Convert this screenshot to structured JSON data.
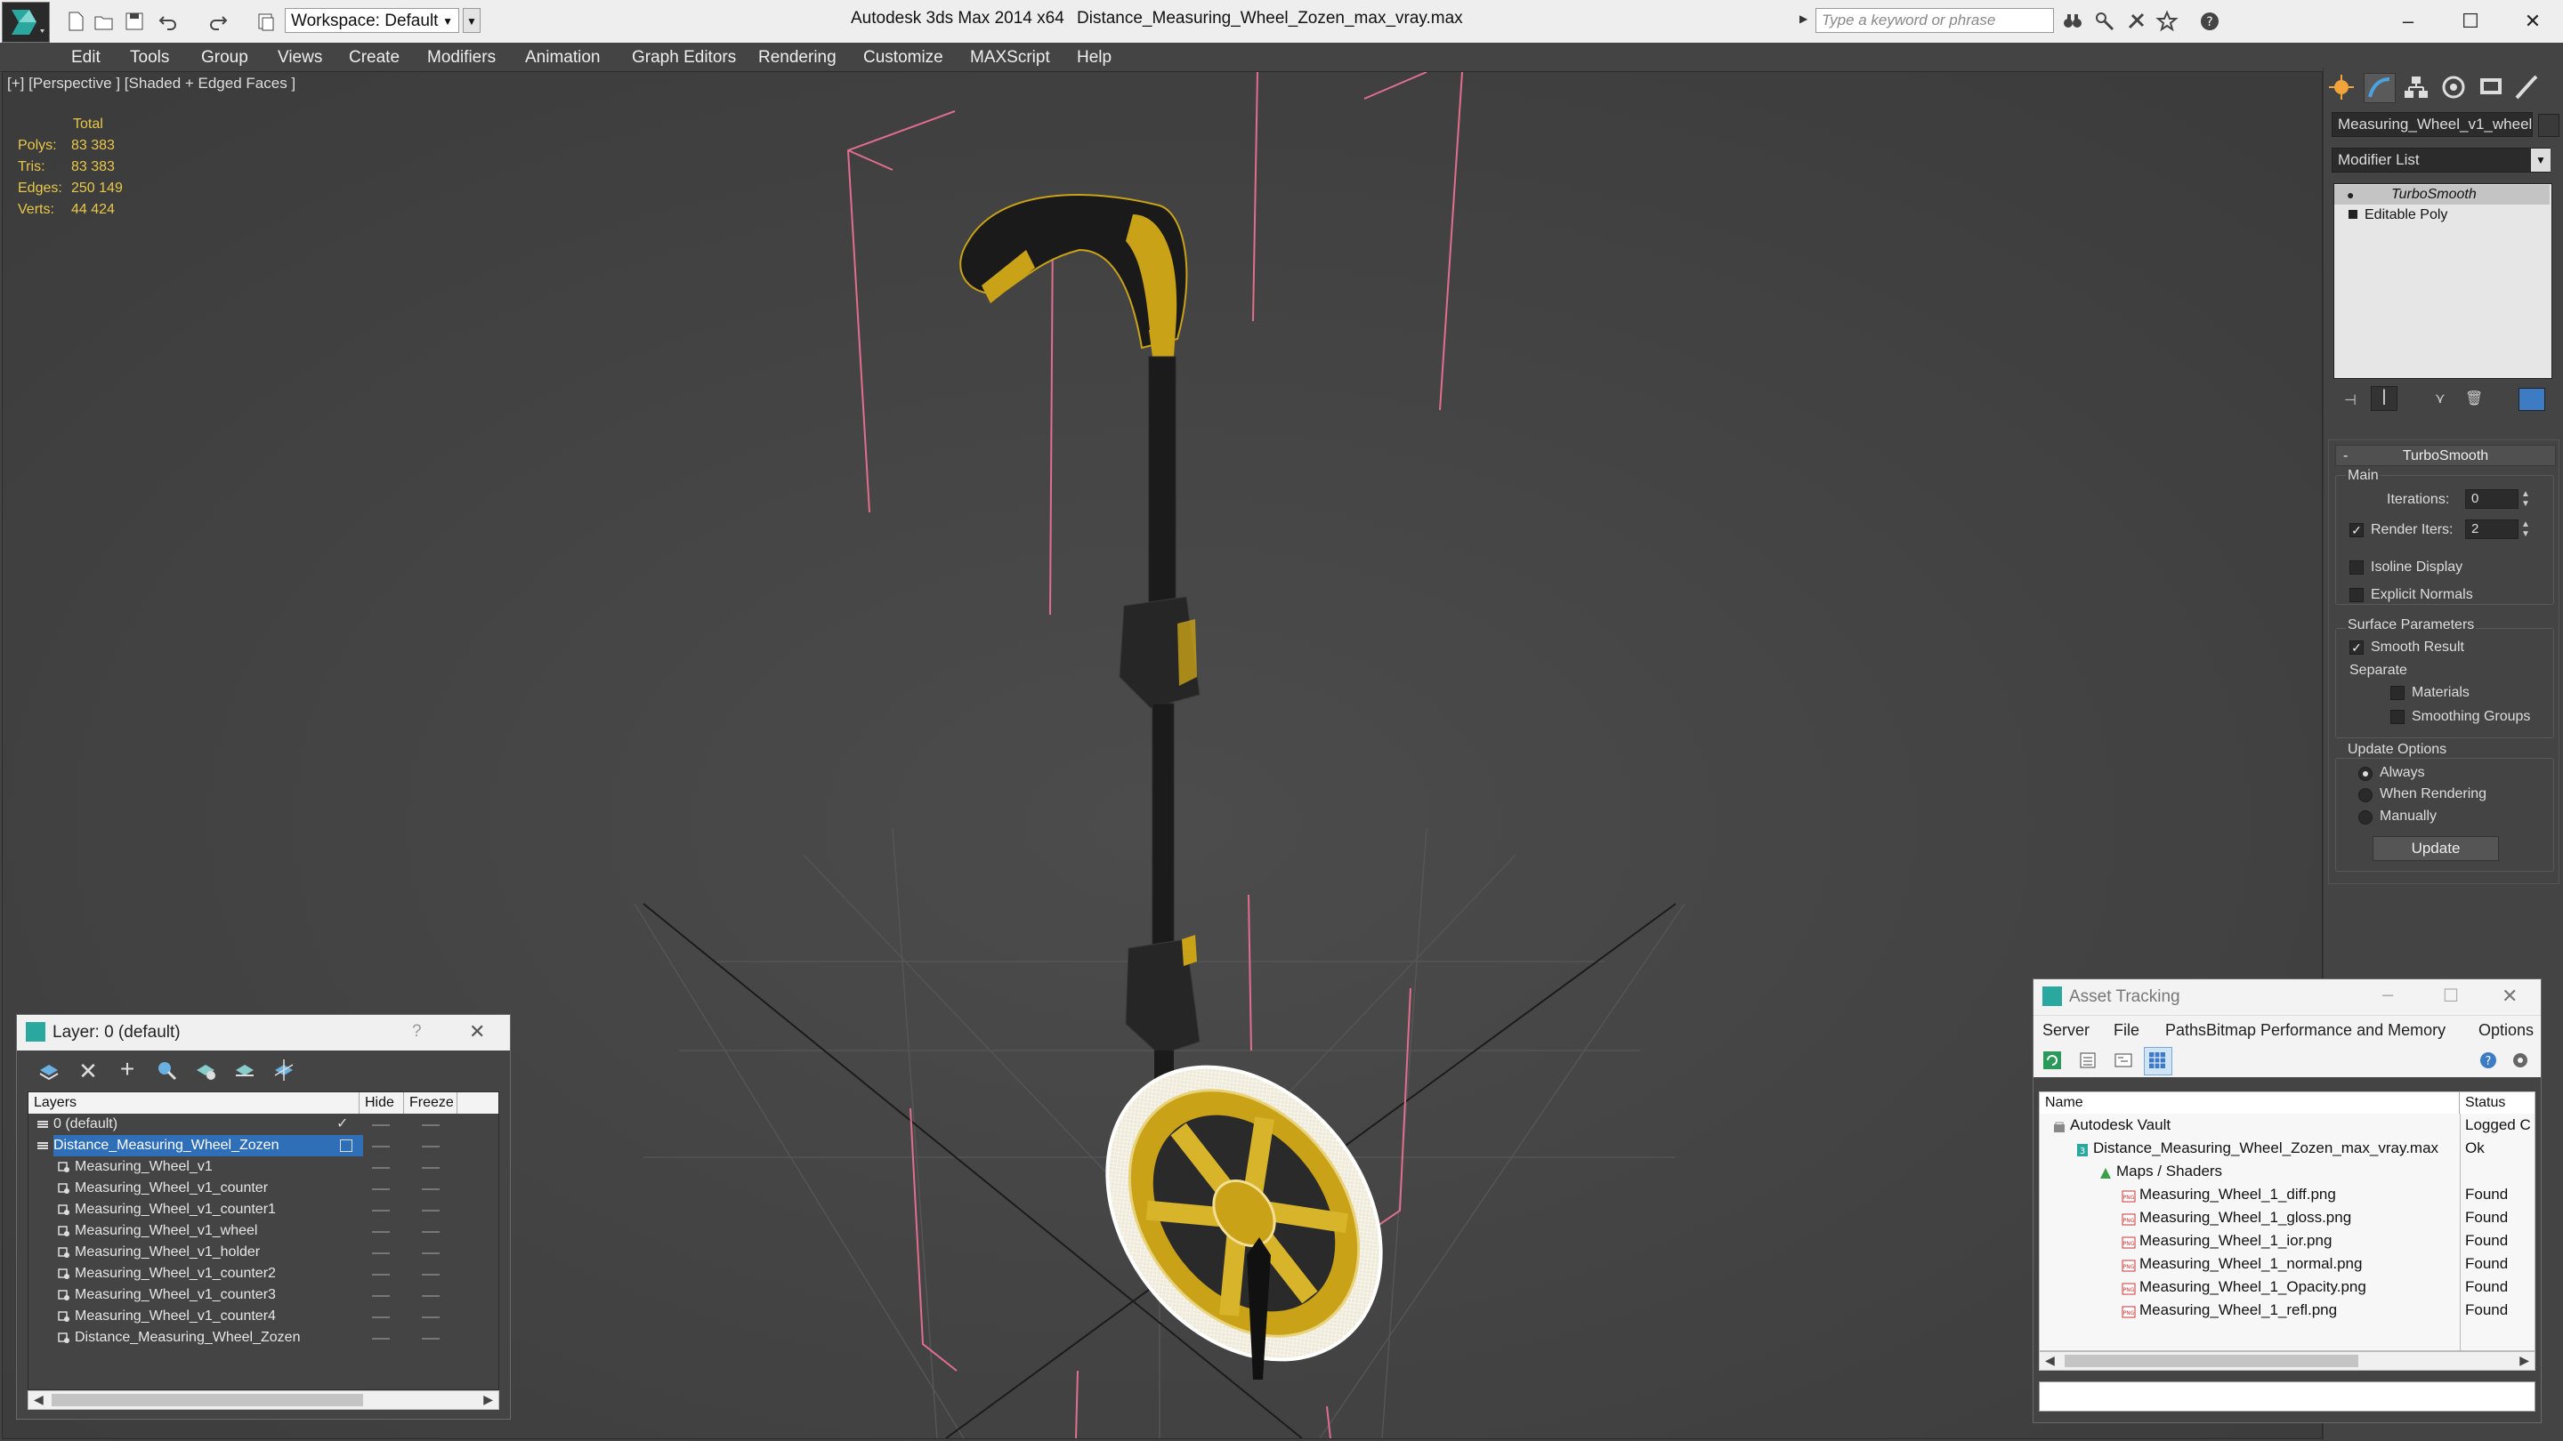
{
  "app": {
    "title": "Autodesk 3ds Max  2014 x64",
    "filename": "Distance_Measuring_Wheel_Zozen_max_vray.max",
    "workspace": "Workspace: Default",
    "search_placeholder": "Type a keyword or phrase"
  },
  "menu": [
    "Edit",
    "Tools",
    "Group",
    "Views",
    "Create",
    "Modifiers",
    "Animation",
    "Graph Editors",
    "Rendering",
    "Customize",
    "MAXScript",
    "Help"
  ],
  "viewport": {
    "label": "[+] [Perspective ] [Shaded + Edged Faces ]",
    "stats": {
      "header": "Total",
      "rows": [
        {
          "label": "Polys:",
          "value": "83 383"
        },
        {
          "label": "Tris:",
          "value": "83 383"
        },
        {
          "label": "Edges:",
          "value": "250 149"
        },
        {
          "label": "Verts:",
          "value": "44 424"
        }
      ]
    }
  },
  "command_panel": {
    "object_name": "Measuring_Wheel_v1_wheel",
    "modifier_list": "Modifier List",
    "stack": [
      "TurboSmooth",
      "Editable Poly"
    ],
    "rollout": "TurboSmooth",
    "main_label": "Main",
    "iterations_label": "Iterations:",
    "iterations_value": "0",
    "render_iters_label": "Render Iters:",
    "render_iters_value": "2",
    "isoline": "Isoline Display",
    "explicit_normals": "Explicit Normals",
    "surface_params": "Surface Parameters",
    "smooth_result": "Smooth Result",
    "separate": "Separate",
    "materials": "Materials",
    "smoothing_groups": "Smoothing Groups",
    "update_options": "Update Options",
    "always": "Always",
    "when_rendering": "When Rendering",
    "manually": "Manually",
    "update_button": "Update"
  },
  "layer_window": {
    "title": "Layer: 0 (default)",
    "help": "?",
    "columns": [
      "Layers",
      "Hide",
      "Freeze"
    ],
    "rows": [
      {
        "name": "0 (default)",
        "indent": 1,
        "type": "layer"
      },
      {
        "name": "Distance_Measuring_Wheel_Zozen",
        "indent": 1,
        "type": "layer",
        "selected": true
      },
      {
        "name": "Measuring_Wheel_v1",
        "indent": 2,
        "type": "object"
      },
      {
        "name": "Measuring_Wheel_v1_counter",
        "indent": 2,
        "type": "object"
      },
      {
        "name": "Measuring_Wheel_v1_counter1",
        "indent": 2,
        "type": "object"
      },
      {
        "name": "Measuring_Wheel_v1_wheel",
        "indent": 2,
        "type": "object"
      },
      {
        "name": "Measuring_Wheel_v1_holder",
        "indent": 2,
        "type": "object"
      },
      {
        "name": "Measuring_Wheel_v1_counter2",
        "indent": 2,
        "type": "object"
      },
      {
        "name": "Measuring_Wheel_v1_counter3",
        "indent": 2,
        "type": "object"
      },
      {
        "name": "Measuring_Wheel_v1_counter4",
        "indent": 2,
        "type": "object"
      },
      {
        "name": "Distance_Measuring_Wheel_Zozen",
        "indent": 2,
        "type": "object"
      }
    ]
  },
  "asset_window": {
    "title": "Asset Tracking",
    "menu": [
      "Server",
      "File",
      "Paths",
      "Bitmap Performance and Memory",
      "Options"
    ],
    "columns": [
      "Name",
      "Status"
    ],
    "rows": [
      {
        "name": "Autodesk Vault",
        "status": "Logged C",
        "indent": 1,
        "icon": "vault"
      },
      {
        "name": "Distance_Measuring_Wheel_Zozen_max_vray.max",
        "status": "Ok",
        "indent": 2,
        "icon": "max"
      },
      {
        "name": "Maps / Shaders",
        "status": "",
        "indent": 3,
        "icon": "maps"
      },
      {
        "name": "Measuring_Wheel_1_diff.png",
        "status": "Found",
        "indent": 4,
        "icon": "png"
      },
      {
        "name": "Measuring_Wheel_1_gloss.png",
        "status": "Found",
        "indent": 4,
        "icon": "png"
      },
      {
        "name": "Measuring_Wheel_1_ior.png",
        "status": "Found",
        "indent": 4,
        "icon": "png"
      },
      {
        "name": "Measuring_Wheel_1_normal.png",
        "status": "Found",
        "indent": 4,
        "icon": "png"
      },
      {
        "name": "Measuring_Wheel_1_Opacity.png",
        "status": "Found",
        "indent": 4,
        "icon": "png"
      },
      {
        "name": "Measuring_Wheel_1_refl.png",
        "status": "Found",
        "indent": 4,
        "icon": "png"
      }
    ]
  }
}
